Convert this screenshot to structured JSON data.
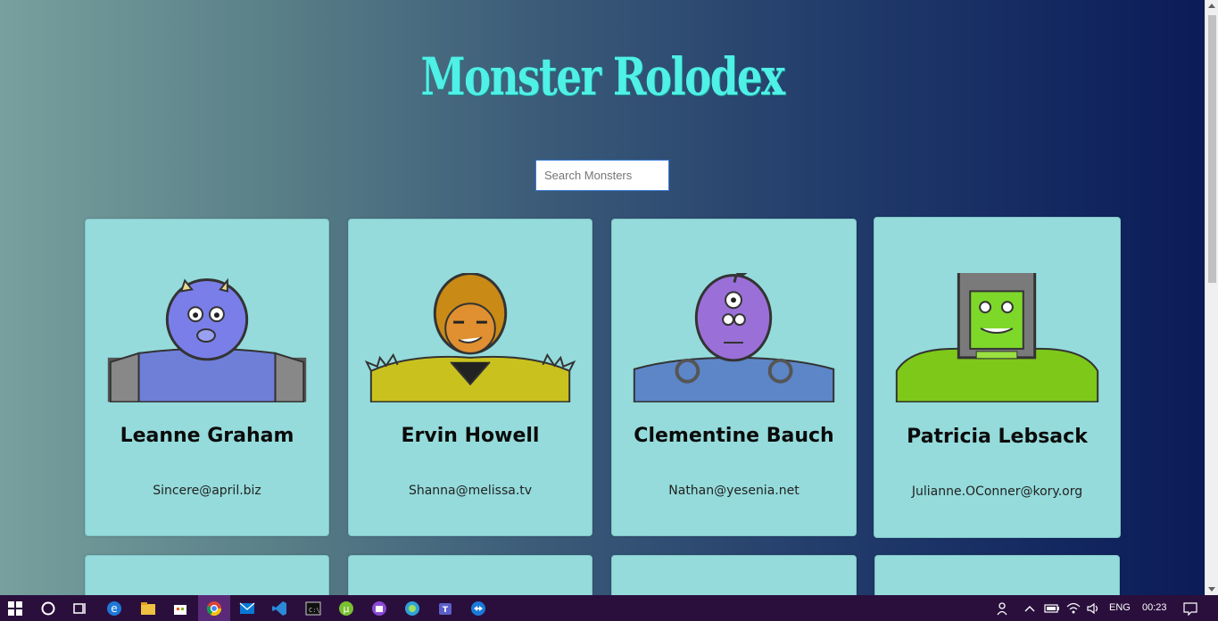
{
  "app": {
    "title": "Monster Rolodex"
  },
  "search": {
    "placeholder": "Search Monsters"
  },
  "monsters": [
    {
      "name": "Leanne Graham",
      "email": "Sincere@april.biz",
      "color": "#7a7ee8"
    },
    {
      "name": "Ervin Howell",
      "email": "Shanna@melissa.tv",
      "color": "#c9c21e"
    },
    {
      "name": "Clementine Bauch",
      "email": "Nathan@yesenia.net",
      "color": "#5c86c8"
    },
    {
      "name": "Patricia Lebsack",
      "email": "Julianne.OConner@kory.org",
      "color": "#7ec81a"
    }
  ],
  "taskbar": {
    "apps": [
      "windows-start-icon",
      "cortana-icon",
      "task-view-icon",
      "edge-icon",
      "file-explorer-icon",
      "store-icon",
      "chrome-icon",
      "mail-icon",
      "vscode-icon",
      "terminal-icon",
      "utorrent-icon",
      "app-icon",
      "browser-icon",
      "teams-icon",
      "teamviewer-icon"
    ],
    "language": "ENG",
    "time": "00:23"
  },
  "colors": {
    "title": "#4ff0e6",
    "card": "#95dbdb",
    "taskbar": "#2a0f3d"
  }
}
